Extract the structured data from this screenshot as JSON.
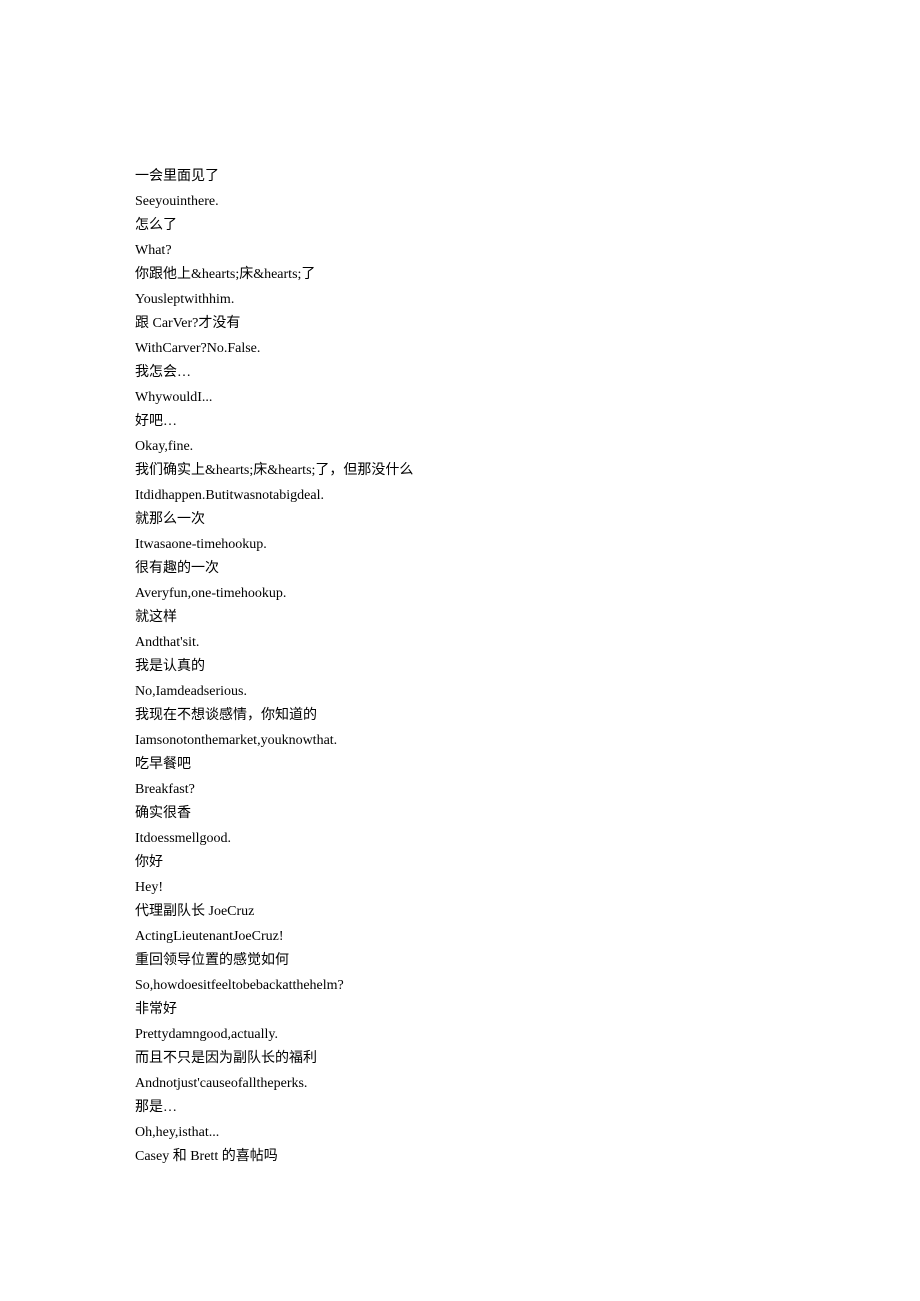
{
  "lines": [
    "一会里面见了",
    "Seeyouinthere.",
    "怎么了",
    "What?",
    "你跟他上&hearts;床&hearts;了",
    "Yousleptwithhim.",
    "跟 CarVer?才没有",
    "WithCarver?No.False.",
    "我怎会…",
    "WhywouldI...",
    "好吧…",
    "Okay,fine.",
    "我们确实上&hearts;床&hearts;了，但那没什么",
    "Itdidhappen.Butitwasnotabigdeal.",
    "就那么一次",
    "Itwasaone-timehookup.",
    "很有趣的一次",
    "Averyfun,one-timehookup.",
    "就这样",
    "Andthat'sit.",
    "我是认真的",
    "No,Iamdeadserious.",
    "我现在不想谈感情，你知道的",
    "Iamsonotonthemarket,youknowthat.",
    "吃早餐吧",
    "Breakfast?",
    "确实很香",
    "Itdoessmellgood.",
    "你好",
    "Hey!",
    "代理副队长 JoeCruz",
    "ActingLieutenantJoeCruz!",
    "重回领导位置的感觉如何",
    "So,howdoesitfeeltobebackatthehelm?",
    "非常好",
    "Prettydamngood,actually.",
    "而且不只是因为副队长的福利",
    "Andnotjust'causeofalltheperks.",
    "那是…",
    "Oh,hey,isthat...",
    "Casey 和 Brett 的喜帖吗"
  ]
}
